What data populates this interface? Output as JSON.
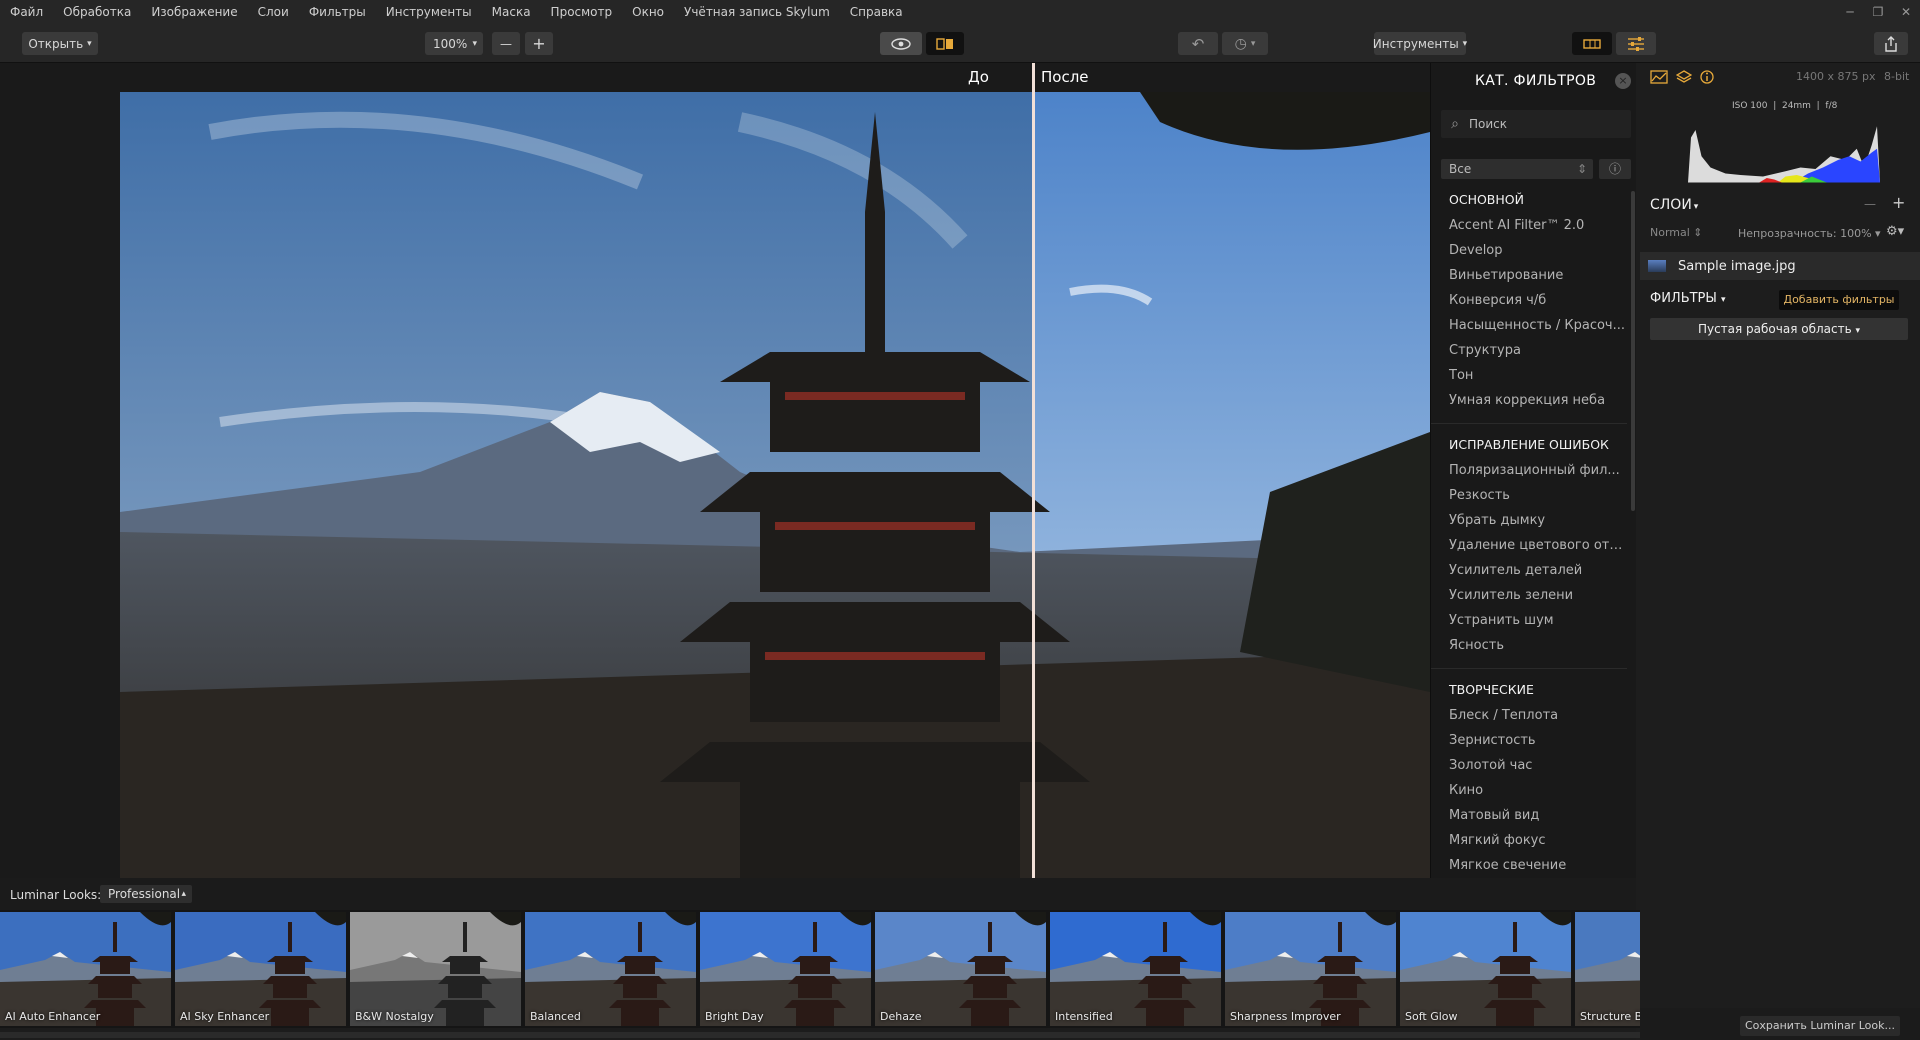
{
  "menu": [
    "Файл",
    "Обработка",
    "Изображение",
    "Слои",
    "Фильтры",
    "Инструменты",
    "Маска",
    "Просмотр",
    "Окно",
    "Учётная запись Skylum",
    "Справка"
  ],
  "toolbar": {
    "open_label": "Открыть",
    "zoom_value": "100%",
    "tools_label": "Инструменты"
  },
  "compare": {
    "before": "До",
    "after": "После"
  },
  "filters_panel": {
    "title": "КАТ. ФИЛЬТРОВ",
    "search_placeholder": "Поиск",
    "category_filter": "Все",
    "sections": [
      {
        "name": "ОСНОВНОЙ",
        "items": [
          "Accent AI Filter™ 2.0",
          "Develop",
          "Виньетирование",
          "Конверсия ч/б",
          "Насыщенность / Красоч...",
          "Структура",
          "Тон",
          "Умная коррекция неба"
        ]
      },
      {
        "name": "ИСПРАВЛЕНИЕ ОШИБОК",
        "items": [
          "Поляризационный фил...",
          "Резкость",
          "Убрать дымку",
          "Удаление цветового отт...",
          "Усилитель деталей",
          "Усилитель зелени",
          "Устранить шум",
          "Ясность"
        ]
      },
      {
        "name": "ТВОРЧЕСКИЕ",
        "items": [
          "Блеск / Теплота",
          "Зернистость",
          "Золотой час",
          "Кино",
          "Матовый вид",
          "Мягкий фокус",
          "Мягкое свечение"
        ]
      }
    ]
  },
  "info": {
    "dimensions": "1400 x 875 px",
    "bitdepth": "8-bit",
    "exif": "ISO 100  |  24mm  |  f/8"
  },
  "layers": {
    "title": "СЛОИ",
    "blend_mode": "Normal",
    "opacity": "Непрозрачность: 100%",
    "layer_name": "Sample image.jpg",
    "filters_title": "ФИЛЬТРЫ",
    "add_filters": "Добавить фильтры",
    "workspace": "Пустая рабочая область"
  },
  "looks": {
    "label": "Luminar Looks:",
    "collection": "Professional",
    "save_label": "Сохранить Luminar Look...",
    "items": [
      "AI Auto Enhancer",
      "AI Sky Enhancer",
      "B&W Nostalgy",
      "Balanced",
      "Bright Day",
      "Dehaze",
      "Intensified",
      "Sharpness Improver",
      "Soft Glow",
      "Structure Bo"
    ]
  }
}
